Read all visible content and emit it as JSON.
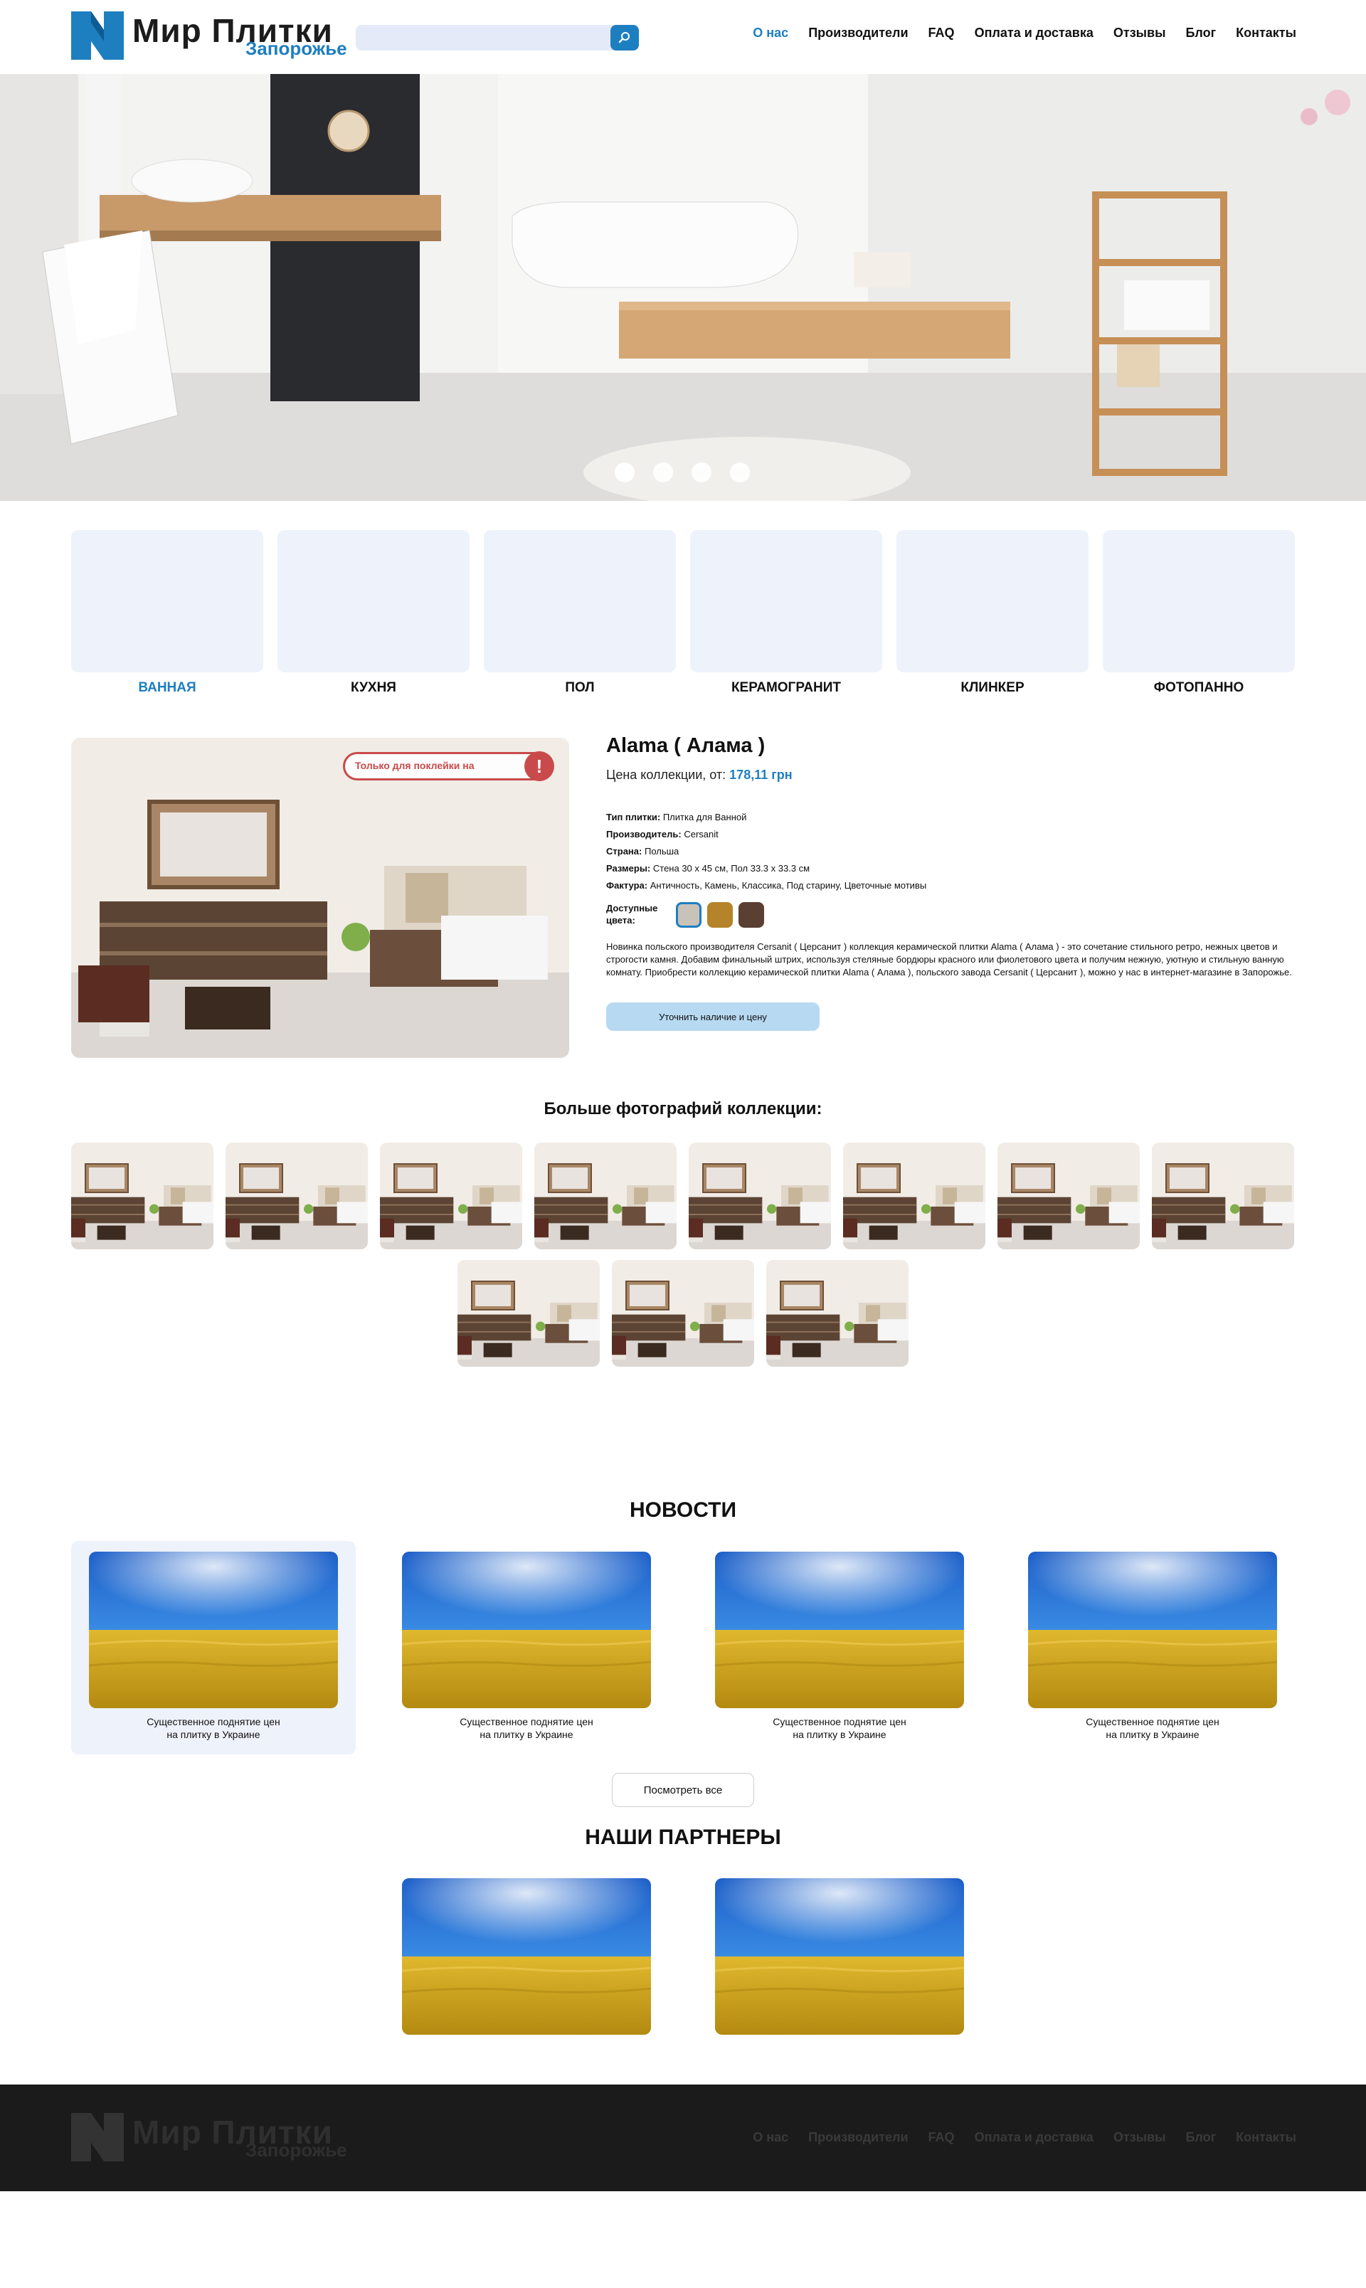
{
  "header": {
    "logo_title": "Мир Плитки",
    "logo_sub": "Запорожье",
    "search_placeholder": "",
    "nav": [
      {
        "label": "О нас",
        "active": true
      },
      {
        "label": "Производители"
      },
      {
        "label": "FAQ"
      },
      {
        "label": "Оплата и доставка"
      },
      {
        "label": "Отзывы"
      },
      {
        "label": "Блог"
      },
      {
        "label": "Контакты"
      }
    ]
  },
  "hero": {
    "slides": 4,
    "active_slide": 1
  },
  "categories": [
    {
      "label": "ВАННАЯ",
      "active": true
    },
    {
      "label": "КУХНЯ"
    },
    {
      "label": "ПОЛ"
    },
    {
      "label": "КЕРАМОГРАНИТ"
    },
    {
      "label": "КЛИНКЕР"
    },
    {
      "label": "ФОТОПАННО"
    }
  ],
  "product": {
    "sticker": "Только для поклейки на",
    "sticker_icon": "!",
    "title": "Alama ( Алама )",
    "price_label": "Цена коллекции, от:",
    "price_value": "178,11 грн",
    "specs": [
      {
        "key": "Тип плитки:",
        "value": "Плитка для Ванной"
      },
      {
        "key": "Производитель:",
        "value": "Cersanit"
      },
      {
        "key": "Страна:",
        "value": "Польша"
      },
      {
        "key": "Размеры:",
        "value": "Стена 30 х 45 см, Пол 33.3 х 33.3 см"
      },
      {
        "key": "Фактура:",
        "value": "Античность, Камень, Классика, Под старину, Цветочные мотивы"
      }
    ],
    "colors_label_1": "Доступные",
    "colors_label_2": "цвета:",
    "colors": [
      "#c9c2b8",
      "#b5832a",
      "#5a3f33"
    ],
    "description": "Новинка  польского производителя  Cersanit ( Церсанит ) коллекция керамической плитки  Alama ( Алама ) - это сочетание стильного ретро, нежных цветов и строгости камня. Добавим финальный штрих, используя стеляные бордюры красного или фиолетового цвета и получим нежную, уютную и стильную ванную комнату. Приобрести коллекцию керамической плитки Alama ( Алама ), польского завода  Cersanit ( Церсанит ), можно у нас в интернет-магазине в Запорожье.",
    "cta": "Уточнить наличие и цену"
  },
  "gallery": {
    "title": "Больше фотографий коллекции:",
    "count": 11
  },
  "news": {
    "title": "НОВОСТИ",
    "items": [
      {
        "line1": "Существенное поднятие цен",
        "line2": "на плитку в Украине",
        "active": true
      },
      {
        "line1": "Существенное поднятие цен",
        "line2": "на плитку в Украине"
      },
      {
        "line1": "Существенное поднятие цен",
        "line2": "на плитку в Украине"
      },
      {
        "line1": "Существенное поднятие цен",
        "line2": "на плитку в Украине"
      }
    ],
    "more": "Посмотреть все"
  },
  "partners": {
    "title": "НАШИ ПАРТНЕРЫ",
    "count": 2
  },
  "footer": {
    "logo_title": "Мир Плитки",
    "logo_sub": "Запорожье",
    "nav": [
      "О нас",
      "Производители",
      "FAQ",
      "Оплата и доставка",
      "Отзывы",
      "Блог",
      "Контакты"
    ]
  }
}
